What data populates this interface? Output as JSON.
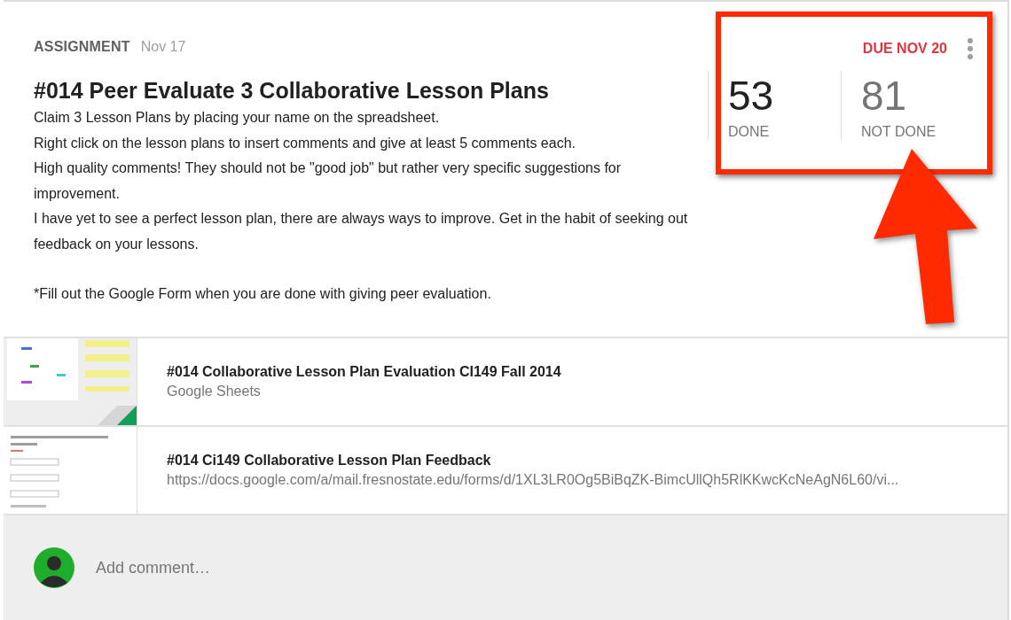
{
  "assignment": {
    "type_label": "ASSIGNMENT",
    "date": "Nov 17",
    "title": "#014 Peer Evaluate 3 Collaborative Lesson Plans",
    "description": [
      "Claim 3 Lesson Plans by placing your name on the spreadsheet.",
      "Right click on the lesson plans to insert comments and give at least 5 comments each.",
      "High quality comments! They should not be \"good job\" but rather very specific suggestions for improvement.",
      "I have yet to see a perfect lesson plan, there are always ways to improve. Get in the habit of seeking out feedback on your lessons.",
      "*Fill out the Google Form when you are done with giving peer evaluation."
    ],
    "due": "DUE NOV 20",
    "stats": [
      {
        "value": "53",
        "label": "DONE"
      },
      {
        "value": "81",
        "label": "NOT DONE"
      }
    ]
  },
  "attachments": [
    {
      "kind": "sheet",
      "title": "#014 Collaborative Lesson Plan Evaluation CI149 Fall 2014",
      "subtitle": "Google Sheets"
    },
    {
      "kind": "form",
      "title": "#014 Ci149 Collaborative Lesson Plan Feedback",
      "subtitle": "https://docs.google.com/a/mail.fresnostate.edu/forms/d/1XL3LR0Og5BiBqZK-BimcUllQh5RlKKwcKcNeAgN6L60/vi..."
    }
  ],
  "comment": {
    "placeholder": "Add comment…"
  }
}
